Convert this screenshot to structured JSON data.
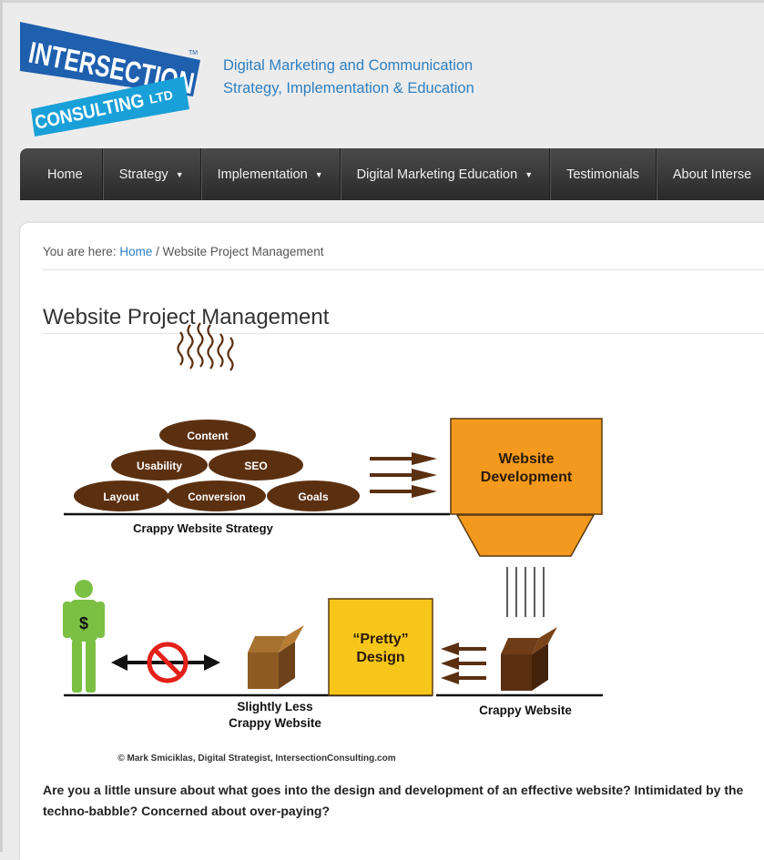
{
  "header": {
    "logo": {
      "line1": "INTERSECTION",
      "line2": "CONSULTING",
      "ltd": "LTD",
      "tm": "TM",
      "colors": {
        "blue": "#1e5fae",
        "cyan": "#1aa0d8"
      }
    },
    "tagline_line1": "Digital Marketing and Communication",
    "tagline_line2": "Strategy, Implementation & Education"
  },
  "nav": {
    "items": [
      {
        "label": "Home",
        "dropdown": false
      },
      {
        "label": "Strategy",
        "dropdown": true
      },
      {
        "label": "Implementation",
        "dropdown": true
      },
      {
        "label": "Digital Marketing Education",
        "dropdown": true
      },
      {
        "label": "Testimonials",
        "dropdown": false
      },
      {
        "label": "About Interse",
        "dropdown": false
      }
    ],
    "caret_glyph": "▼"
  },
  "breadcrumb": {
    "prefix": "You are here: ",
    "home": "Home",
    "separator": " / ",
    "current": "Website Project Management"
  },
  "page_title": "Website Project Management",
  "diagram": {
    "pile_labels": {
      "content": "Content",
      "usability": "Usability",
      "seo": "SEO",
      "layout": "Layout",
      "conversion": "Conversion",
      "goals": "Goals"
    },
    "strategy_caption": "Crappy Website Strategy",
    "website_dev_line1": "Website",
    "website_dev_line2": "Development",
    "pretty_line1": "“Pretty”",
    "pretty_line2": "Design",
    "crappy_website": "Crappy Website",
    "slightly_less_line1": "Slightly Less",
    "slightly_less_line2": "Crappy Website",
    "dollar": "$",
    "credit": "© Mark Smiciklas, Digital Strategist, IntersectionConsulting.com",
    "colors": {
      "brown": "#5b3011",
      "orange": "#f39a1e",
      "yellow": "#f7c61b",
      "green": "#7cc043",
      "red": "#e32119"
    }
  },
  "intro_text": "Are you a little unsure about what goes into the design and development of an effective website? Intimidated by the techno-babble? Concerned about over-paying?"
}
